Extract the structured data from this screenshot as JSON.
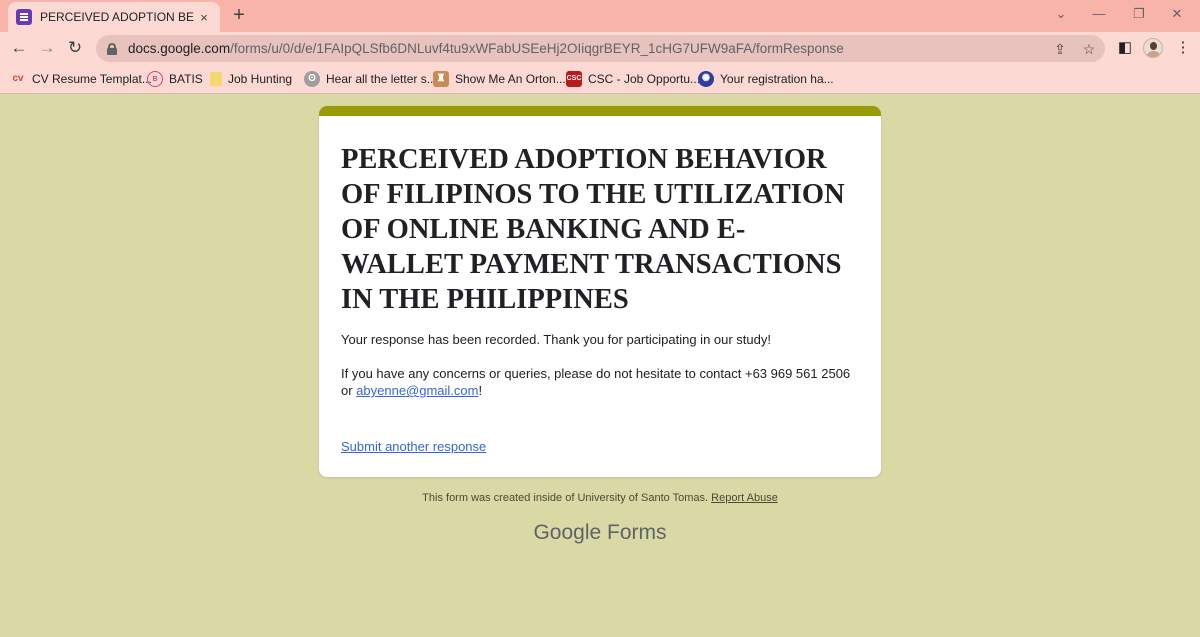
{
  "browser": {
    "tab_title": "PERCEIVED ADOPTION BEHAVIO",
    "tab_close": "×",
    "new_tab": "+",
    "url_host": "docs.google.com",
    "url_path": "/forms/u/0/d/e/1FAIpQLSfb6DNLuvf4tu9xWFabUSEeHj2OIiqgrBEYR_1cHG7UFW9aFA/formResponse",
    "colors": {
      "tabstrip": "#f8b4a8",
      "toolbar": "#fcd9d3",
      "omnibox": "#e8c2bd"
    }
  },
  "bookmarks": [
    {
      "label": "CV Resume Templat...",
      "icon": "cv-icon"
    },
    {
      "label": "BATIS",
      "icon": "batis-icon"
    },
    {
      "label": "Job Hunting",
      "icon": "folder-icon"
    },
    {
      "label": "Hear all the letter s...",
      "icon": "koala-icon"
    },
    {
      "label": "Show Me An Orton...",
      "icon": "reader-icon"
    },
    {
      "label": "CSC - Job Opportu...",
      "icon": "csc-icon"
    },
    {
      "label": "Your registration ha...",
      "icon": "seal-icon"
    }
  ],
  "form": {
    "accent_color": "#9a9a0c",
    "background_color": "#d9d9a6",
    "title": "PERCEIVED ADOPTION BEHAVIOR OF FILIPINOS TO THE UTILIZATION OF ONLINE BANKING AND E-WALLET PAYMENT TRANSACTIONS IN THE PHILIPPINES",
    "confirmation": "Your response has been recorded. Thank you for participating in our study!",
    "contact_prefix": "If you have any concerns or queries, please do not hesitate to contact +63 969 561 2506 or ",
    "contact_email": "abyenne@gmail.com",
    "contact_suffix": "!",
    "submit_another": "Submit another response"
  },
  "footer": {
    "created_text": "This form was created inside of University of Santo Tomas.",
    "report_abuse": "Report Abuse",
    "brand_google": "Google",
    "brand_forms": "Forms"
  }
}
